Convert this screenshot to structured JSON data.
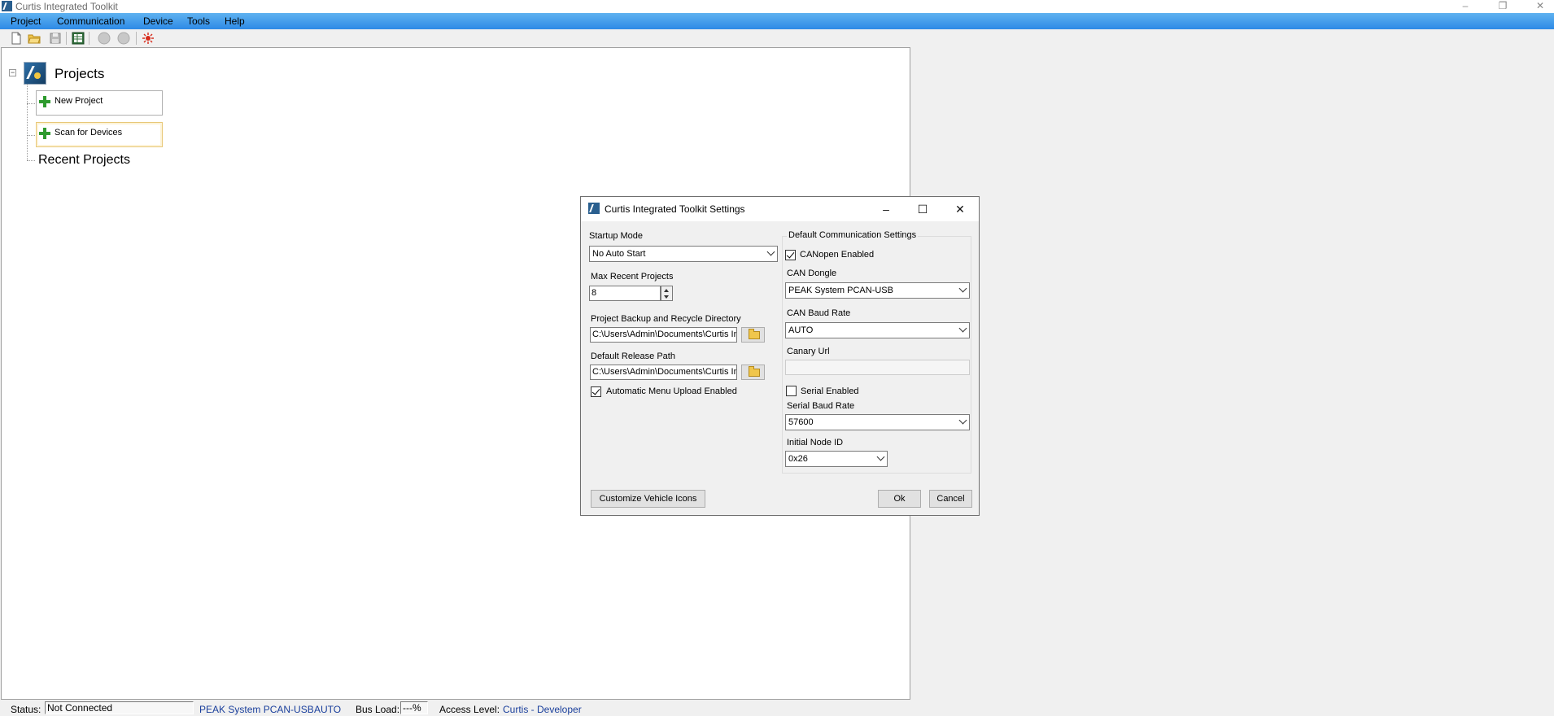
{
  "window": {
    "title": "Curtis Integrated Toolkit",
    "controls": {
      "minimize": "–",
      "restore": "❐",
      "close": "✕"
    }
  },
  "menu": {
    "items": [
      {
        "label": "Project"
      },
      {
        "label": "Communication"
      },
      {
        "label": "Device"
      },
      {
        "label": "Tools"
      },
      {
        "label": "Help"
      }
    ]
  },
  "toolbar": {
    "icons": [
      "new-document-icon",
      "open-folder-icon",
      "save-icon",
      "spreadsheet-icon",
      "disconnected-circle-icon",
      "disconnected-circle-icon",
      "sun-icon"
    ]
  },
  "tree": {
    "root_label": "Projects",
    "new_project": "New Project",
    "scan_devices": "Scan for Devices",
    "recent_projects": "Recent Projects"
  },
  "dialog": {
    "title": "Curtis Integrated Toolkit Settings",
    "startup_mode": {
      "label": "Startup Mode",
      "value": "No Auto Start"
    },
    "max_recent": {
      "label": "Max Recent Projects",
      "value": "8"
    },
    "backup_dir": {
      "label": "Project Backup and Recycle Directory",
      "value": "C:\\Users\\Admin\\Documents\\Curtis Integrated Toolkit"
    },
    "release_path": {
      "label": "Default Release Path",
      "value": "C:\\Users\\Admin\\Documents\\Curtis Integrated Toolkit"
    },
    "auto_menu_upload": {
      "label": "Automatic Menu Upload Enabled",
      "checked": true
    },
    "comm_group_title": "Default Communication Settings",
    "canopen": {
      "label": "CANopen Enabled",
      "checked": true
    },
    "can_dongle": {
      "label": "CAN Dongle",
      "value": "PEAK System PCAN-USB"
    },
    "can_baud": {
      "label": "CAN Baud Rate",
      "value": "AUTO"
    },
    "canary_url": {
      "label": "Canary Url",
      "value": ""
    },
    "serial": {
      "label": "Serial Enabled",
      "checked": false
    },
    "serial_baud": {
      "label": "Serial Baud Rate",
      "value": "57600"
    },
    "node_id": {
      "label": "Initial Node ID",
      "value": "0x26"
    },
    "customize_button": "Customize Vehicle Icons",
    "ok_button": "Ok",
    "cancel_button": "Cancel"
  },
  "status": {
    "status_label": "Status:",
    "status_value": "Not Connected",
    "dongle": "PEAK System PCAN-USB",
    "baud": "AUTO",
    "bus_load_label": "Bus Load:",
    "bus_load_value": "---%",
    "access_label": "Access Level:",
    "access_value": "Curtis - Developer"
  },
  "colors": {
    "menubar": "#2d8ae6",
    "status_blue": "#1a3f9c",
    "plus_green": "#2e9a2e"
  }
}
